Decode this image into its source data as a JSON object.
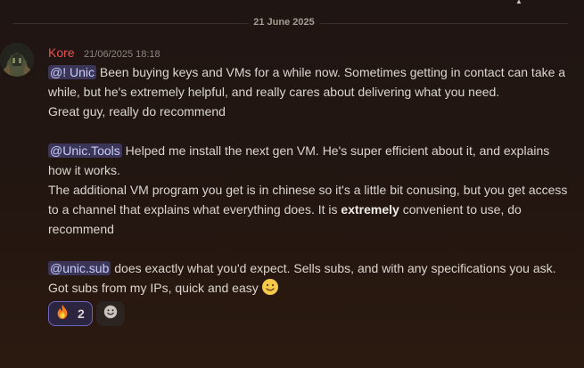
{
  "divider": {
    "date": "21 June 2025"
  },
  "message": {
    "username": "Kore",
    "timestamp": "21/06/2025 18:18",
    "lines": {
      "l1_mention": "@! Unic",
      "l1_text": " Been buying keys and VMs for a while now. Sometimes getting in contact can take a while, but he's extremely helpful, and really cares about delivering what you need.",
      "l2": "Great guy, really do recommend",
      "l3_mention": "@Unic.Tools",
      "l3_text": " Helped me install the next gen VM. He's super efficient about it, and explains how it works.",
      "l4_text_a": "The additional VM program you get is in chinese so it's a little bit conusing, but you get access to a channel that explains what everything does. It is ",
      "l4_bold": "extremely",
      "l4_text_b": " convenient to use, do recommend",
      "l5_mention": "@unic.sub",
      "l5_text": " does exactly what you'd expect. Sells subs, and with any specifications you ask. Got subs from my IPs, quick and easy"
    },
    "inline_emoji": "slightly-smiling-face",
    "reactions": [
      {
        "emoji": "fire-emoji",
        "count": "2"
      }
    ],
    "add_reaction_icon": "add-reaction-smile-icon"
  },
  "colors": {
    "username": "#e8524f",
    "mention_bg": "#3b3558",
    "reaction_border": "#6c65c4"
  }
}
